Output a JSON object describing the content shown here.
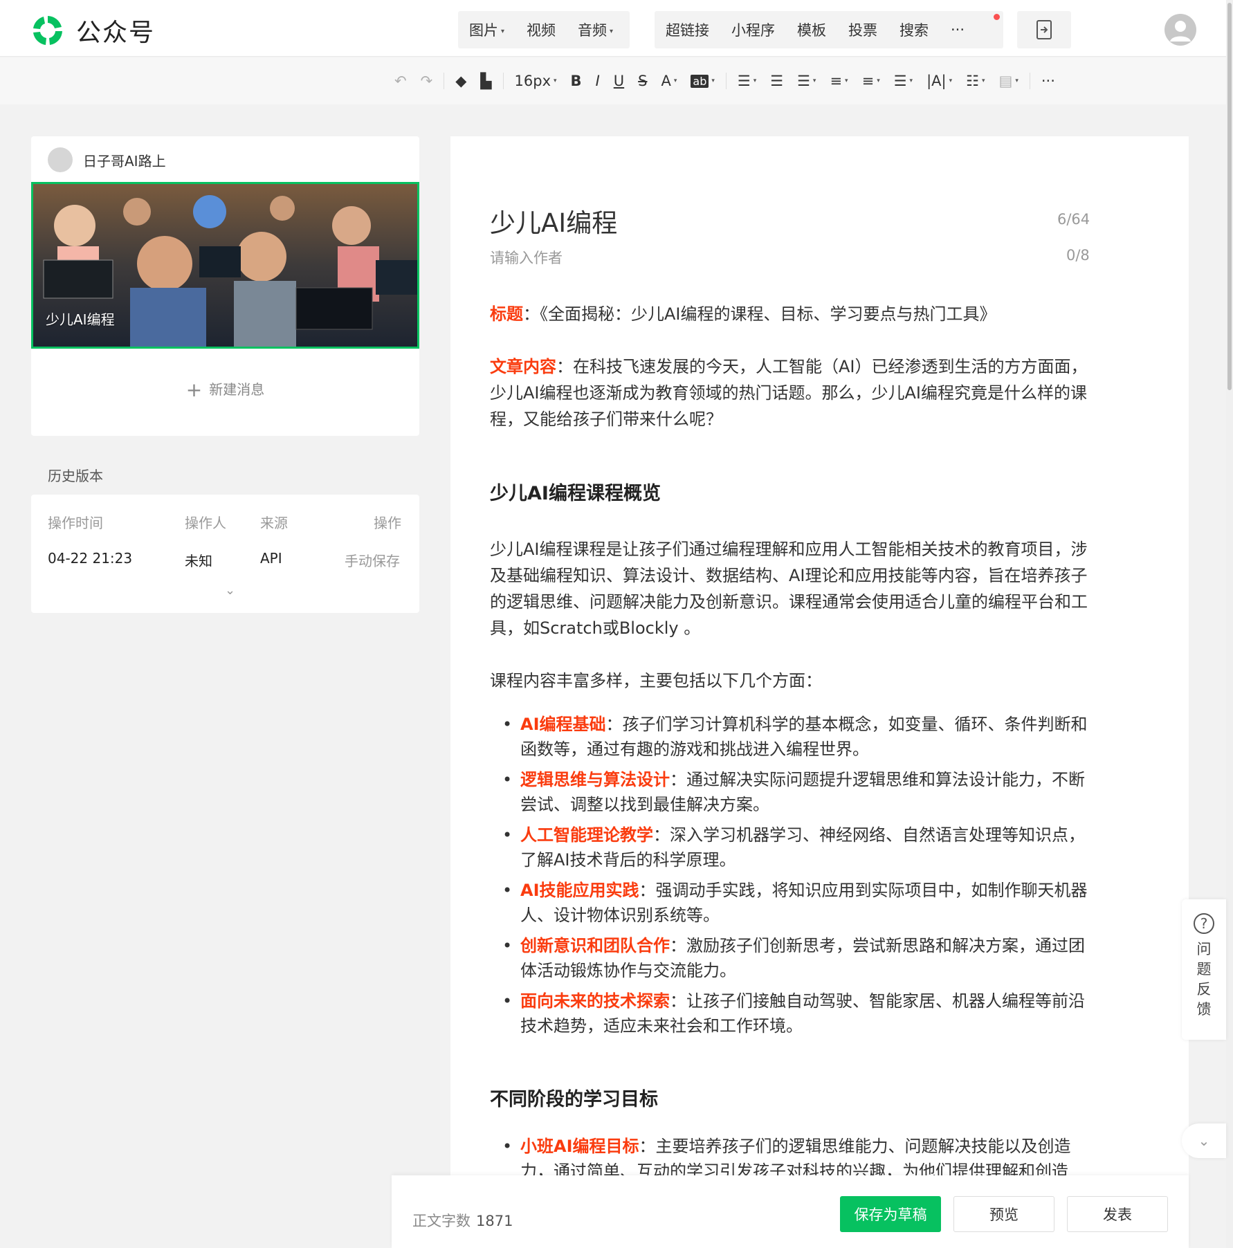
{
  "header": {
    "app_title": "公众号",
    "brand_color": "#07c160",
    "insert_menu": [
      "图片",
      "视频",
      "音频"
    ],
    "insert_menu_extra": [
      "超链接",
      "小程序",
      "模板",
      "投票",
      "搜索",
      "···"
    ],
    "more_label": "···"
  },
  "format_toolbar": {
    "font_size": "16px",
    "bold": "B",
    "italic": "I",
    "underline": "U",
    "strike": "S",
    "font_color": "A",
    "highlight": "ab",
    "letter_spacing": "|A|",
    "more": "···"
  },
  "sidebar": {
    "account_name": "日子哥AI路上",
    "cover_title": "少儿AI编程",
    "new_message": "新建消息",
    "history_title": "历史版本",
    "history_headers": [
      "操作时间",
      "操作人",
      "来源",
      "操作"
    ],
    "history_rows": [
      {
        "time": "04-22 21:23",
        "operator": "未知",
        "source": "API",
        "action": "手动保存"
      }
    ]
  },
  "editor": {
    "title": "少儿AI编程",
    "title_count": "6/64",
    "author_placeholder": "请输入作者",
    "author_count": "0/8",
    "p1_label": "标题",
    "p1_text": "：《全面揭秘：少儿AI编程的课程、目标、学习要点与热门工具》",
    "p2_label": "文章内容",
    "p2_text": "：在科技飞速发展的今天，人工智能（AI）已经渗透到生活的方方面面，少儿AI编程也逐渐成为教育领域的热门话题。那么，少儿AI编程究竟是什么样的课程，又能给孩子们带来什么呢？",
    "h1": "少儿AI编程课程概览",
    "p3": "少儿AI编程课程是让孩子们通过编程理解和应用人工智能相关技术的教育项目，涉及基础编程知识、算法设计、数据结构、AI理论和应用技能等内容，旨在培养孩子的逻辑思维、问题解决能力及创新意识。课程通常会使用适合儿童的编程平台和工具，如Scratch或Blockly 。",
    "p4": "课程内容丰富多样，主要包括以下几个方面：",
    "bullets": [
      {
        "label": "AI编程基础",
        "text": "：孩子们学习计算机科学的基本概念，如变量、循环、条件判断和函数等，通过有趣的游戏和挑战进入编程世界。"
      },
      {
        "label": "逻辑思维与算法设计",
        "text": "：通过解决实际问题提升逻辑思维和算法设计能力，不断尝试、调整以找到最佳解决方案。"
      },
      {
        "label": "人工智能理论教学",
        "text": "：深入学习机器学习、神经网络、自然语言处理等知识点，了解AI技术背后的科学原理。"
      },
      {
        "label": "AI技能应用实践",
        "text": "：强调动手实践，将知识应用到实际项目中，如制作聊天机器人、设计物体识别系统等。"
      },
      {
        "label": "创新意识和团队合作",
        "text": "：激励孩子们创新思考，尝试新思路和解决方案，通过团体活动锻炼协作与交流能力。"
      },
      {
        "label": "面向未来的技术探索",
        "text": "：让孩子们接触自动驾驶、智能家居、机器人编程等前沿技术趋势，适应未来社会和工作环境。"
      }
    ],
    "h2": "不同阶段的学习目标",
    "bullets2": [
      {
        "label": "小班AI编程目标",
        "text": "：主要培养孩子们的逻辑思维能力、问题解决技能以及创造力，通过简单、互动的学习引发孩子对科技的兴趣，为他们提供理解和创造"
      }
    ]
  },
  "footer": {
    "word_count_label": "正文字数",
    "word_count": "1871",
    "save_draft": "保存为草稿",
    "preview": "预览",
    "publish": "发表"
  },
  "feedback": {
    "q_icon": "?",
    "label": "问题反馈",
    "to_bottom": "⌄"
  }
}
